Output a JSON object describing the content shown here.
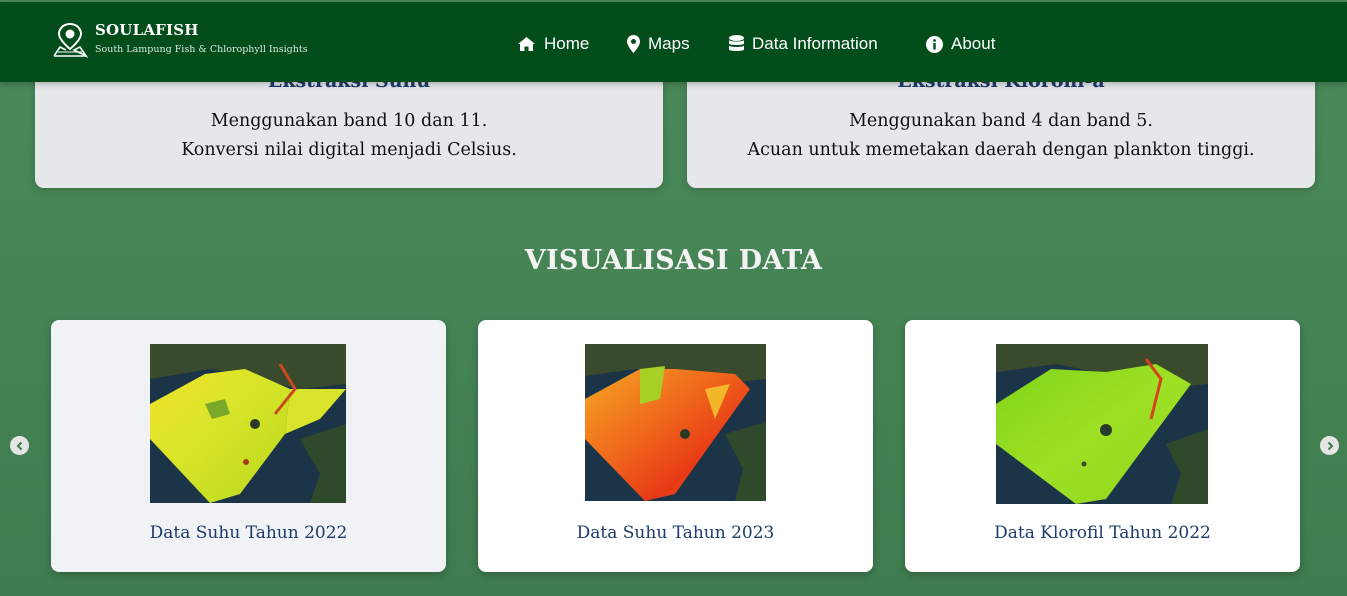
{
  "navbar": {
    "brand_name": "SOULAFISH",
    "brand_tagline": "South Lampung Fish & Chlorophyll Insights",
    "items": [
      {
        "label": "Home",
        "icon": "home-icon"
      },
      {
        "label": "Maps",
        "icon": "map-marker-icon"
      },
      {
        "label": "Data Information",
        "icon": "database-icon"
      },
      {
        "label": "About",
        "icon": "info-circle-icon"
      }
    ]
  },
  "info_cards": [
    {
      "title": "Ekstraksi Suhu",
      "lines": [
        "Menggunakan band 10 dan 11.",
        "Konversi nilai digital menjadi Celsius."
      ]
    },
    {
      "title": "Ekstraksi Klorofil-a",
      "lines": [
        "Menggunakan band 4 dan band 5.",
        "Acuan untuk memetakan daerah dengan plankton tinggi."
      ]
    }
  ],
  "visualization": {
    "title": "VISUALISASI DATA",
    "cards": [
      {
        "caption": "Data Suhu Tahun 2022"
      },
      {
        "caption": "Data Suhu Tahun 2023"
      },
      {
        "caption": "Data Klorofil Tahun 2022"
      }
    ],
    "prev_icon": "chevron-left-circle-icon",
    "next_icon": "chevron-right-circle-icon"
  },
  "colors": {
    "navbar": "#034d1b",
    "background": "#468556",
    "caption_text": "#1d3c6a"
  }
}
